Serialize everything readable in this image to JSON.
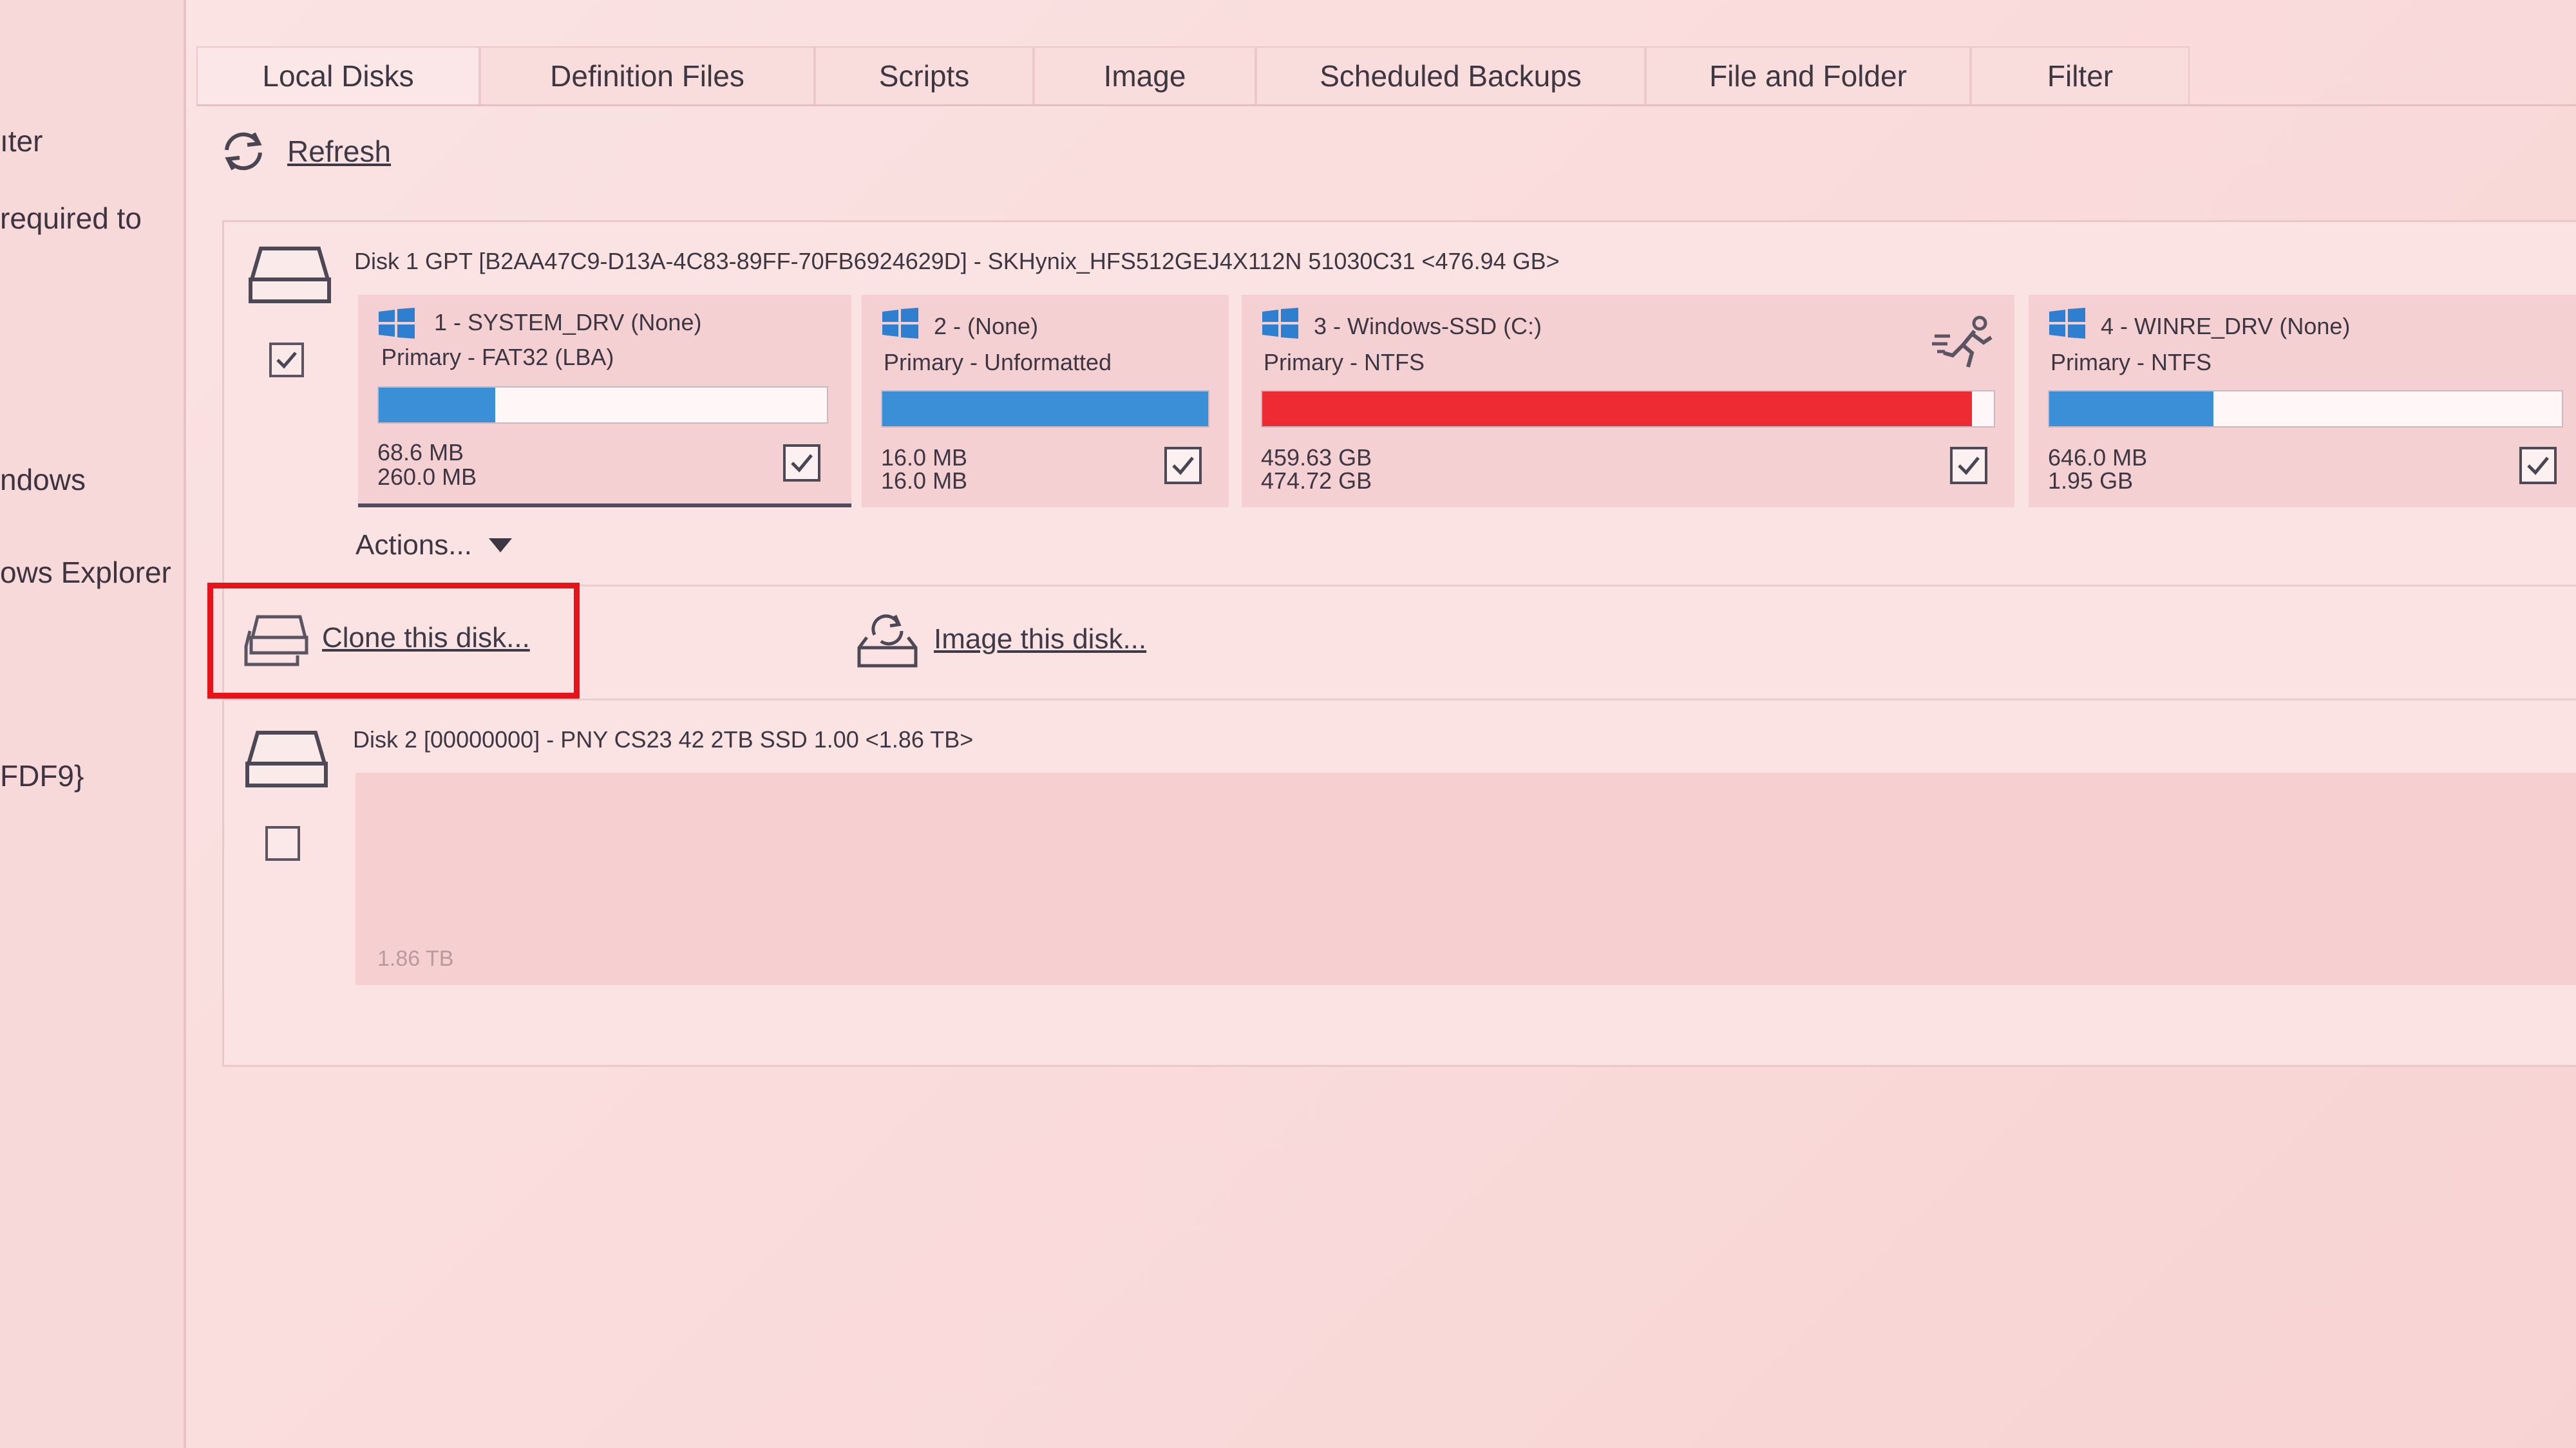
{
  "left_panel": {
    "items": [
      "ıter",
      "required to",
      "ndows",
      "ows Explorer",
      "FDF9}"
    ]
  },
  "tabs": [
    "Local Disks",
    "Definition Files",
    "Scripts",
    "Image",
    "Scheduled Backups",
    "File and Folder",
    "Filter"
  ],
  "toolbar": {
    "refresh_label": "Refresh"
  },
  "disk1": {
    "header": "Disk 1 GPT [B2AA47C9-D13A-4C83-89FF-70FB6924629D] - SKHynix_HFS512GEJ4X112N 51030C31  <476.94 GB>",
    "checked": true,
    "partitions": [
      {
        "name": "1 - SYSTEM_DRV (None)",
        "type": "Primary - FAT32 (LBA)",
        "used": "68.6 MB",
        "total": "260.0 MB",
        "fill_pct": 26,
        "color": "#3a8fd6",
        "checked": true
      },
      {
        "name": "2 -  (None)",
        "type": "Primary - Unformatted",
        "used": "16.0 MB",
        "total": "16.0 MB",
        "fill_pct": 100,
        "color": "#3a8fd6",
        "checked": true
      },
      {
        "name": "3 - Windows-SSD (C:)",
        "type": "Primary - NTFS",
        "used": "459.63 GB",
        "total": "474.72 GB",
        "fill_pct": 97,
        "color": "#ee2b33",
        "checked": true,
        "icon": "running-man-icon"
      },
      {
        "name": "4 - WINRE_DRV (None)",
        "type": "Primary - NTFS",
        "used": "646.0 MB",
        "total": "1.95 GB",
        "fill_pct": 32,
        "color": "#3a8fd6",
        "checked": true
      }
    ]
  },
  "actions": {
    "label": "Actions...",
    "clone_label": "Clone this disk...",
    "image_label": "Image this disk..."
  },
  "disk2": {
    "header": "Disk 2 [00000000] - PNY CS23 42 2TB SSD      1.00   <1.86 TB>",
    "checked": false,
    "size_label": "1.86 TB"
  },
  "colors": {
    "highlight": "#e8121a",
    "bar_blue": "#3a8fd6",
    "bar_red": "#ee2b33"
  },
  "icons": [
    "refresh-icon",
    "disk-icon",
    "windows-logo-icon",
    "checkmark-icon",
    "dropdown-arrow-icon",
    "clone-disk-icon",
    "image-disk-icon",
    "running-man-icon"
  ]
}
